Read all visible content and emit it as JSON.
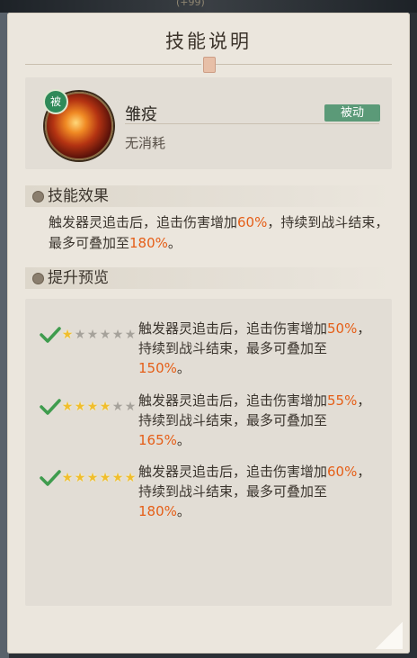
{
  "header": {
    "top_fragment": "(+99)",
    "title": "技能说明"
  },
  "skill": {
    "name": "雏疫",
    "cost": "无消耗",
    "type_tag": "被动",
    "badge": "被"
  },
  "effect": {
    "heading": "技能效果",
    "text_before": "触发器灵追击后，追击伤害增加",
    "increase": "60%",
    "text_middle": "，持续到战斗结束，最多可叠加至",
    "max": "180%",
    "text_after": "。"
  },
  "preview": {
    "heading": "提升预览",
    "levels": [
      {
        "stars_on": 1,
        "stars_total": 6,
        "line1": "触发器灵追击后，追击伤害增加",
        "increase": "50%",
        "comma": "，",
        "line2": "持续到战斗结束，最多可叠加至",
        "max": "150%",
        "end": "。"
      },
      {
        "stars_on": 4,
        "stars_total": 6,
        "line1": "触发器灵追击后，追击伤害增加",
        "increase": "55%",
        "comma": "，",
        "line2": "持续到战斗结束，最多可叠加至",
        "max": "165%",
        "end": "。"
      },
      {
        "stars_on": 6,
        "stars_total": 6,
        "line1": "触发器灵追击后，追击伤害增加",
        "increase": "60%",
        "comma": "，",
        "line2": "持续到战斗结束，最多可叠加至",
        "max": "180%",
        "end": "。"
      }
    ]
  },
  "colors": {
    "highlight": "#e55e17",
    "passive_tag": "#5b9a78",
    "star_on": "#f0be2e",
    "star_off": "#a6a29b"
  },
  "icons": {
    "check": "green-check-icon",
    "star": "star-icon",
    "section": "bullet-dot-icon"
  }
}
